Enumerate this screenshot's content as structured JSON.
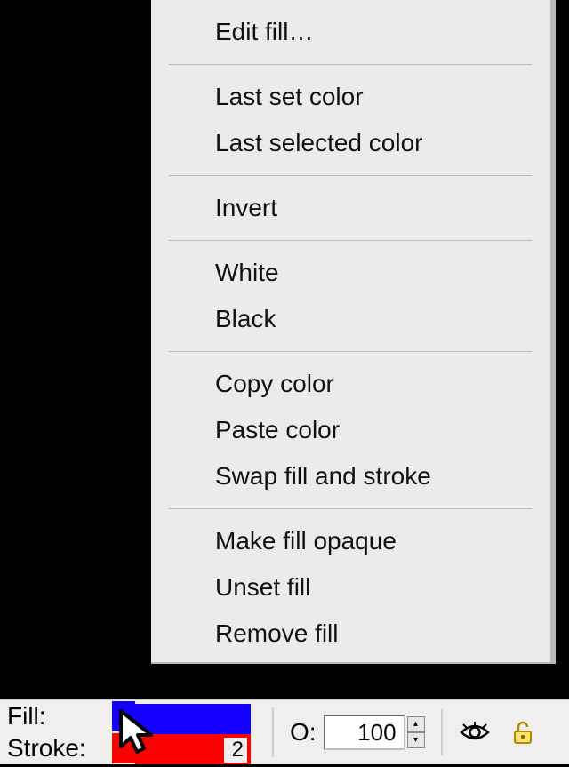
{
  "menu": {
    "items": [
      "Edit fill…",
      "Last set color",
      "Last selected color",
      "Invert",
      "White",
      "Black",
      "Copy color",
      "Paste color",
      "Swap fill and stroke",
      "Make fill opaque",
      "Unset fill",
      "Remove fill"
    ]
  },
  "statusbar": {
    "fill_label": "Fill:",
    "stroke_label": "Stroke:",
    "fill_color": "#1400ff",
    "stroke_color": "#fd0000",
    "stroke_width": "2",
    "opacity_label": "O:",
    "opacity_value": "100"
  },
  "spinner": {
    "up": "▴",
    "down": "▾"
  }
}
